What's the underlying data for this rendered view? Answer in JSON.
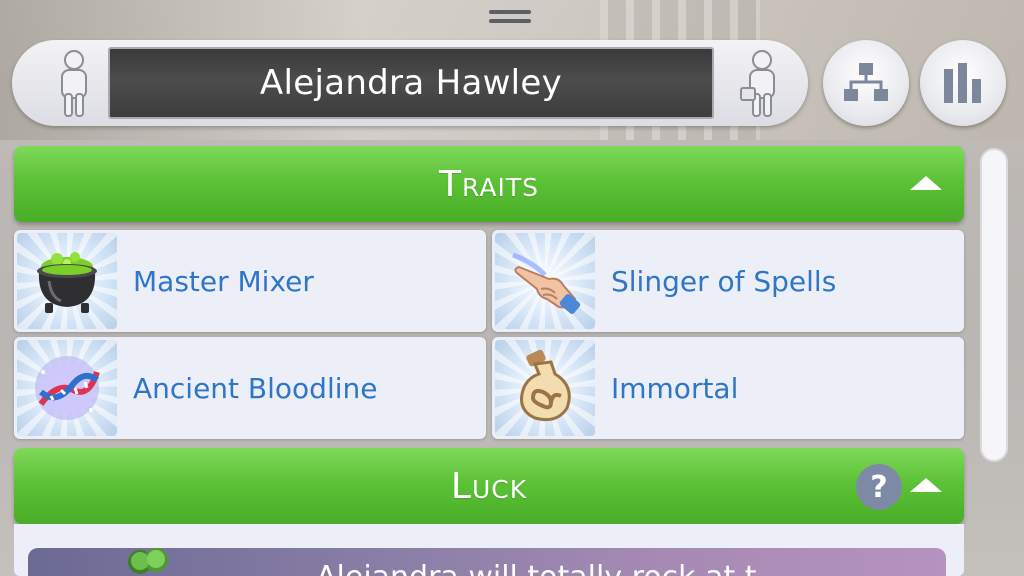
{
  "sim": {
    "name": "Alejandra Hawley"
  },
  "header_buttons": {
    "family_icon": "family-tree-icon",
    "stats_icon": "bar-chart-icon"
  },
  "sections": {
    "traits": {
      "title": "Traits",
      "collapse_icon": "chevron-up-icon"
    },
    "luck": {
      "title": "Luck",
      "help_label": "?",
      "collapse_icon": "chevron-up-icon",
      "message_partial": "Alejandra will totally rock at t"
    }
  },
  "traits": [
    {
      "label": "Master Mixer",
      "icon": "cauldron-icon"
    },
    {
      "label": "Slinger of Spells",
      "icon": "spell-hand-icon"
    },
    {
      "label": "Ancient Bloodline",
      "icon": "dna-icon"
    },
    {
      "label": "Immortal",
      "icon": "infinity-potion-icon"
    }
  ],
  "colors": {
    "header_green": "#5cc236",
    "trait_text_blue": "#2f76c8",
    "card_bg": "#eceff7",
    "name_field_bg": "#3d3d3d"
  }
}
